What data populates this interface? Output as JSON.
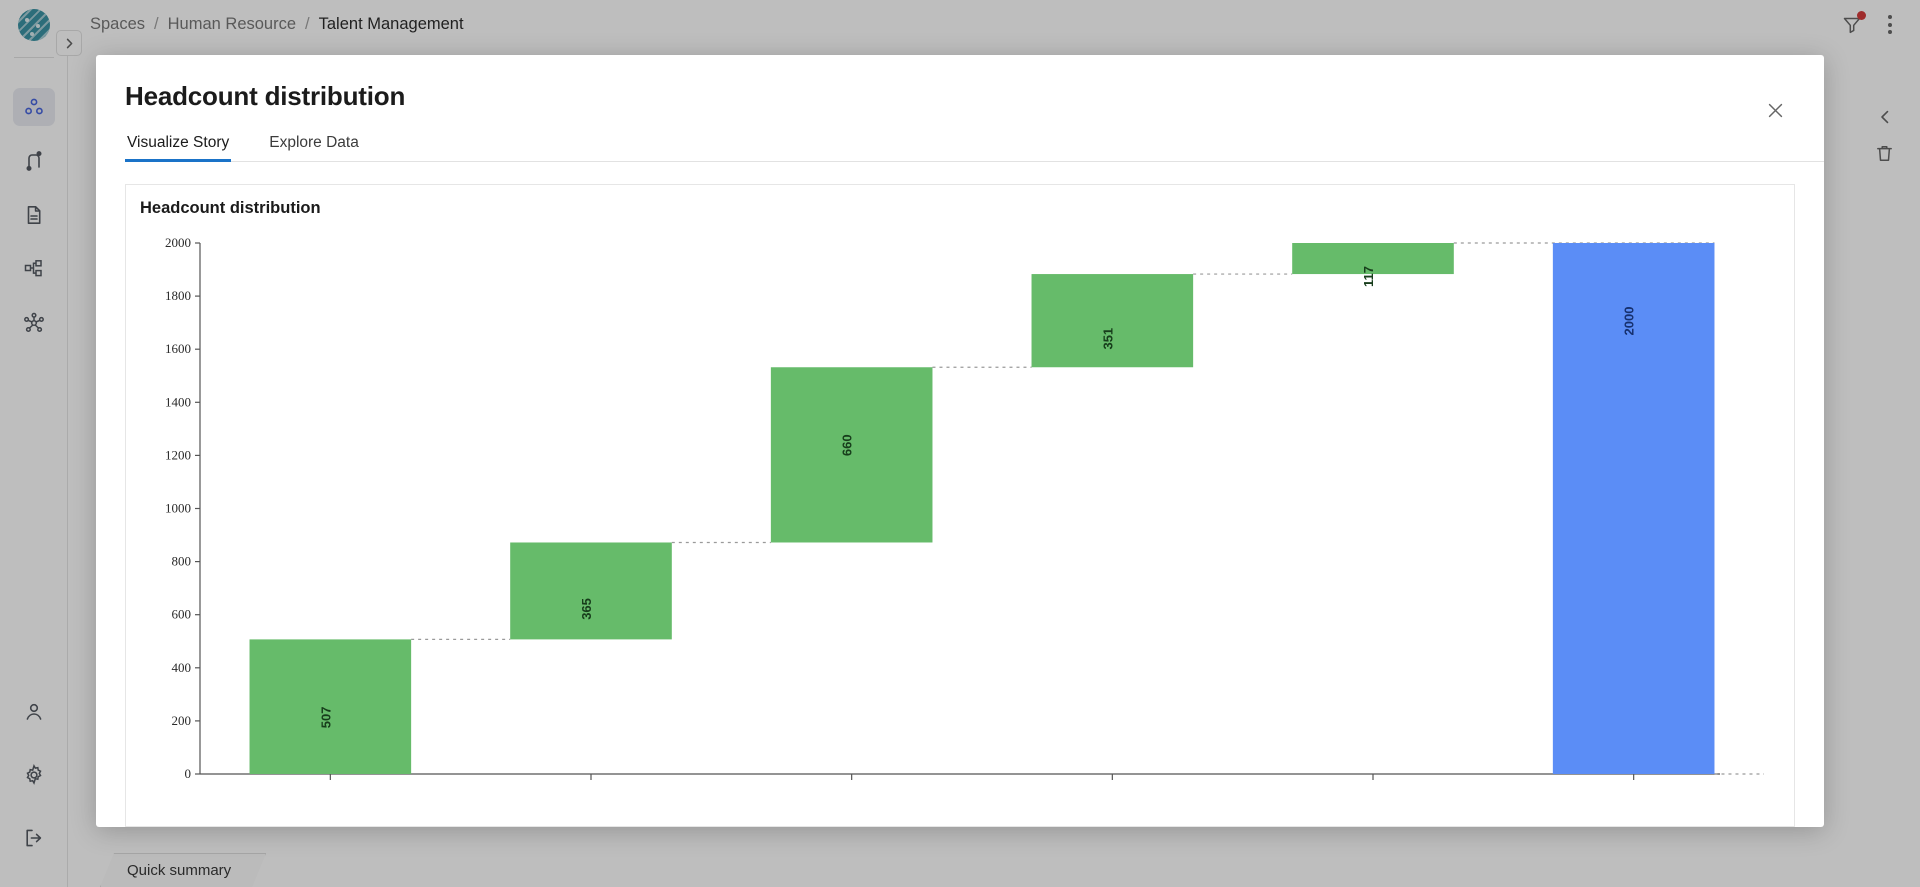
{
  "app": {
    "logo_icon": "app-logo-icon",
    "breadcrumb": [
      {
        "label": "Spaces",
        "current": false
      },
      {
        "label": "Human Resource",
        "current": false
      },
      {
        "label": "Talent Management",
        "current": true
      }
    ],
    "separator": "/",
    "topbar_icons": [
      {
        "name": "filter-icon",
        "badge": true
      },
      {
        "name": "more-options-icon",
        "badge": false
      }
    ],
    "side_tools": [
      {
        "name": "collapse-chevron-icon"
      },
      {
        "name": "delete-icon"
      }
    ],
    "sidebar": {
      "expand_icon": "chevron-right-icon",
      "top_items": [
        {
          "name": "sidebar-item-spaces",
          "icon": "spaces-nodes-icon",
          "active": true
        },
        {
          "name": "sidebar-item-flows",
          "icon": "flow-pipeline-icon",
          "active": false
        },
        {
          "name": "sidebar-item-documents",
          "icon": "document-icon",
          "active": false
        },
        {
          "name": "sidebar-item-hierarchy",
          "icon": "sitemap-icon",
          "active": false
        },
        {
          "name": "sidebar-item-network",
          "icon": "network-graph-icon",
          "active": false
        }
      ],
      "bottom_items": [
        {
          "name": "sidebar-item-profile",
          "icon": "user-icon"
        },
        {
          "name": "sidebar-item-settings",
          "icon": "gear-icon"
        },
        {
          "name": "sidebar-item-logout",
          "icon": "logout-icon"
        }
      ]
    },
    "quick_summary_tab": "Quick summary"
  },
  "modal": {
    "title": "Headcount distribution",
    "close_icon": "close-icon",
    "tabs": [
      {
        "label": "Visualize Story",
        "active": true
      },
      {
        "label": "Explore Data",
        "active": false
      }
    ],
    "card_title": "Headcount distribution"
  },
  "chart_data": {
    "type": "bar",
    "subtype": "waterfall",
    "title": "Headcount distribution",
    "xlabel": "",
    "ylabel": "",
    "ylim": [
      0,
      2000
    ],
    "ytick_step": 200,
    "yticks": [
      0,
      200,
      400,
      600,
      800,
      1000,
      1200,
      1400,
      1600,
      1800,
      2000
    ],
    "grid": false,
    "legend": false,
    "connectors": true,
    "colors": {
      "increase": "#66bb6a",
      "total": "#5b8df6",
      "connector": "#9a9a9a",
      "axis": "#555555"
    },
    "categories": [
      "",
      "",
      "",
      "",
      "",
      ""
    ],
    "values": [
      507,
      365,
      660,
      351,
      117,
      2000
    ],
    "kinds": [
      "relative",
      "relative",
      "relative",
      "relative",
      "relative",
      "total"
    ],
    "bases": [
      0,
      507,
      872,
      1532,
      1883,
      0
    ],
    "tops": [
      507,
      872,
      1532,
      1883,
      2000,
      2000
    ],
    "labels": [
      "507",
      "365",
      "660",
      "351",
      "117",
      "2000"
    ],
    "label_rotation": -90,
    "xtick_labels_truncated": true
  }
}
